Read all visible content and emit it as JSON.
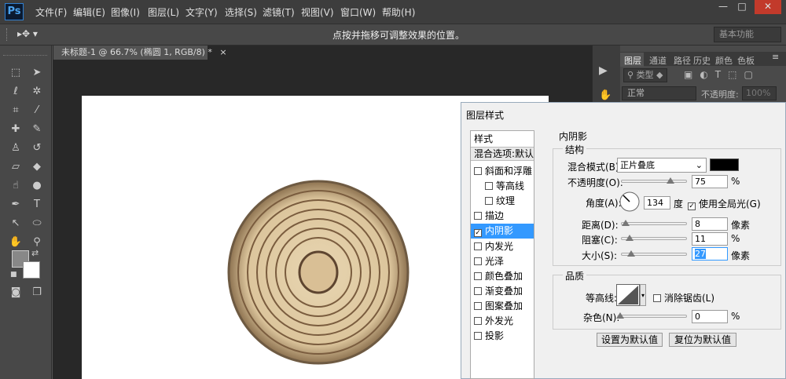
{
  "app": {
    "logo": "Ps",
    "colors": {
      "accent": "#3399ff",
      "menubar": "#3d3d3d",
      "canvas_bg": "#282828"
    }
  },
  "menu": [
    "文件(F)",
    "编辑(E)",
    "图像(I)",
    "图层(L)",
    "文字(Y)",
    "选择(S)",
    "滤镜(T)",
    "视图(V)",
    "窗口(W)",
    "帮助(H)"
  ],
  "window_controls": {
    "minimize": "—",
    "maximize": "□",
    "close": "✕"
  },
  "options_bar": {
    "hint": "点按并拖移可调整效果的位置。",
    "workspace": "基本功能"
  },
  "document": {
    "tab_title": "未标题-1 @ 66.7% (椭圆 1, RGB/8) *",
    "close": "×"
  },
  "layers_panel": {
    "tabs": [
      "图层",
      "通道",
      "路径",
      "历史",
      "颜色",
      "色板"
    ],
    "filter_kind": "类型",
    "blend_mode": "正常",
    "opacity_label": "不透明度:",
    "opacity_value": "100%"
  },
  "dialog": {
    "title": "图层样式",
    "styles_header": "样式",
    "blend_options": "混合选项:默认",
    "style_items": [
      {
        "label": "斜面和浮雕",
        "checked": false,
        "indent": false
      },
      {
        "label": "等高线",
        "checked": false,
        "indent": true
      },
      {
        "label": "纹理",
        "checked": false,
        "indent": true
      },
      {
        "label": "描边",
        "checked": false,
        "indent": false
      },
      {
        "label": "内阴影",
        "checked": true,
        "indent": false
      },
      {
        "label": "内发光",
        "checked": false,
        "indent": false
      },
      {
        "label": "光泽",
        "checked": false,
        "indent": false
      },
      {
        "label": "颜色叠加",
        "checked": false,
        "indent": false
      },
      {
        "label": "渐变叠加",
        "checked": false,
        "indent": false
      },
      {
        "label": "图案叠加",
        "checked": false,
        "indent": false
      },
      {
        "label": "外发光",
        "checked": false,
        "indent": false
      },
      {
        "label": "投影",
        "checked": false,
        "indent": false
      }
    ],
    "section_title": "内阴影",
    "structure": {
      "title": "结构",
      "blend_mode_label": "混合模式(B):",
      "blend_mode_value": "正片叠底",
      "shadow_color": "#000000",
      "opacity_label": "不透明度(O):",
      "opacity_value": "75",
      "opacity_unit": "%",
      "angle_label": "角度(A):",
      "angle_value": "134",
      "angle_unit": "度",
      "global_light_label": "使用全局光(G)",
      "global_light_checked": true,
      "distance_label": "距离(D):",
      "distance_value": "8",
      "distance_unit": "像素",
      "choke_label": "阻塞(C):",
      "choke_value": "11",
      "choke_unit": "%",
      "size_label": "大小(S):",
      "size_value": "27",
      "size_unit": "像素"
    },
    "quality": {
      "title": "品质",
      "contour_label": "等高线:",
      "antialias_label": "消除锯齿(L)",
      "antialias_checked": false,
      "noise_label": "杂色(N):",
      "noise_value": "0",
      "noise_unit": "%"
    },
    "buttons": {
      "make_default": "设置为默认值",
      "reset_default": "复位为默认值"
    }
  }
}
